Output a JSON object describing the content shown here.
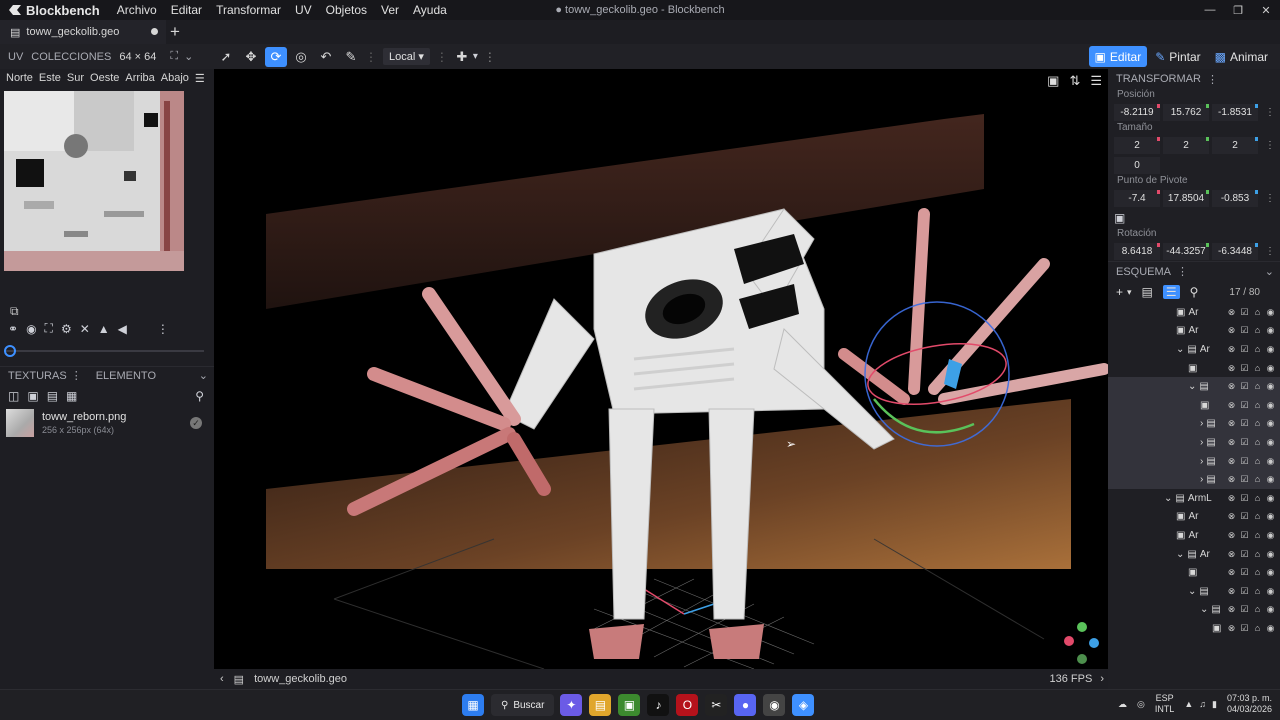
{
  "app": {
    "name": "Blockbench",
    "window_title": "● toww_geckolib.geo - Blockbench",
    "menu": [
      "Archivo",
      "Editar",
      "Transformar",
      "UV",
      "Objetos",
      "Ver",
      "Ayuda"
    ]
  },
  "tab": {
    "title": "toww_geckolib.geo",
    "add": "+"
  },
  "toolbar": {
    "uv_label": "UV",
    "collections_label": "COLECCIONES",
    "uv_size": "64 × 64",
    "transform_space": "Local",
    "modes": [
      {
        "label": "Editar",
        "icon": "cube-icon"
      },
      {
        "label": "Pintar",
        "icon": "brush-icon"
      },
      {
        "label": "Animar",
        "icon": "film-icon"
      }
    ],
    "active_mode": "Editar"
  },
  "uv_panel": {
    "faces": [
      "Norte",
      "Este",
      "Sur",
      "Oeste",
      "Arriba",
      "Abajo"
    ],
    "slider_value": 0
  },
  "textures_panel": {
    "tabs": [
      "TEXTURAS",
      "ELEMENTO"
    ],
    "items": [
      {
        "name": "toww_reborn.png",
        "size": "256 x 256px (64x)"
      }
    ]
  },
  "transform_panel": {
    "title": "TRANSFORMAR",
    "position_label": "Posición",
    "position": [
      "-8.2119",
      "15.762",
      "-1.8531"
    ],
    "size_label": "Tamaño",
    "size": [
      "2",
      "2",
      "2"
    ],
    "inflate": "0",
    "pivot_label": "Punto de Pivote",
    "pivot": [
      "-7.4",
      "17.8504",
      "-0.853"
    ],
    "rotation_label": "Rotación",
    "rotation": [
      "8.6418",
      "-44.3257",
      "-6.3448"
    ]
  },
  "outliner": {
    "title": "ESQUEMA",
    "count": "17 / 80",
    "rows": [
      {
        "label": "Ar",
        "type": "cube",
        "indent": 1
      },
      {
        "label": "Ar",
        "type": "cube",
        "indent": 1
      },
      {
        "label": "Ar",
        "type": "group-open",
        "indent": 1
      },
      {
        "label": "",
        "type": "cube",
        "indent": 2
      },
      {
        "label": "",
        "type": "group-open",
        "indent": 2,
        "selected": true
      },
      {
        "label": "",
        "type": "cube",
        "indent": 3,
        "selected": true
      },
      {
        "label": "",
        "type": "group-closed",
        "indent": 3,
        "selected": true
      },
      {
        "label": "",
        "type": "group-closed",
        "indent": 3,
        "selected": true
      },
      {
        "label": "",
        "type": "group-closed",
        "indent": 3,
        "selected": true
      },
      {
        "label": "",
        "type": "group-closed",
        "indent": 3,
        "selected": true
      },
      {
        "label": "ArmL",
        "type": "group-open",
        "indent": 0
      },
      {
        "label": "Ar",
        "type": "cube",
        "indent": 1
      },
      {
        "label": "Ar",
        "type": "cube",
        "indent": 1
      },
      {
        "label": "Ar",
        "type": "group-open",
        "indent": 1
      },
      {
        "label": "",
        "type": "cube",
        "indent": 2
      },
      {
        "label": "",
        "type": "group-open",
        "indent": 2
      },
      {
        "label": "",
        "type": "group-open",
        "indent": 3
      },
      {
        "label": "",
        "type": "cube",
        "indent": 4
      }
    ]
  },
  "status": {
    "file": "toww_geckolib.geo",
    "fps": "136 FPS"
  },
  "taskbar": {
    "search": "Buscar",
    "lang": [
      "ESP",
      "INTL"
    ],
    "time": "07:03 p. m.",
    "date": "04/03/2026"
  }
}
